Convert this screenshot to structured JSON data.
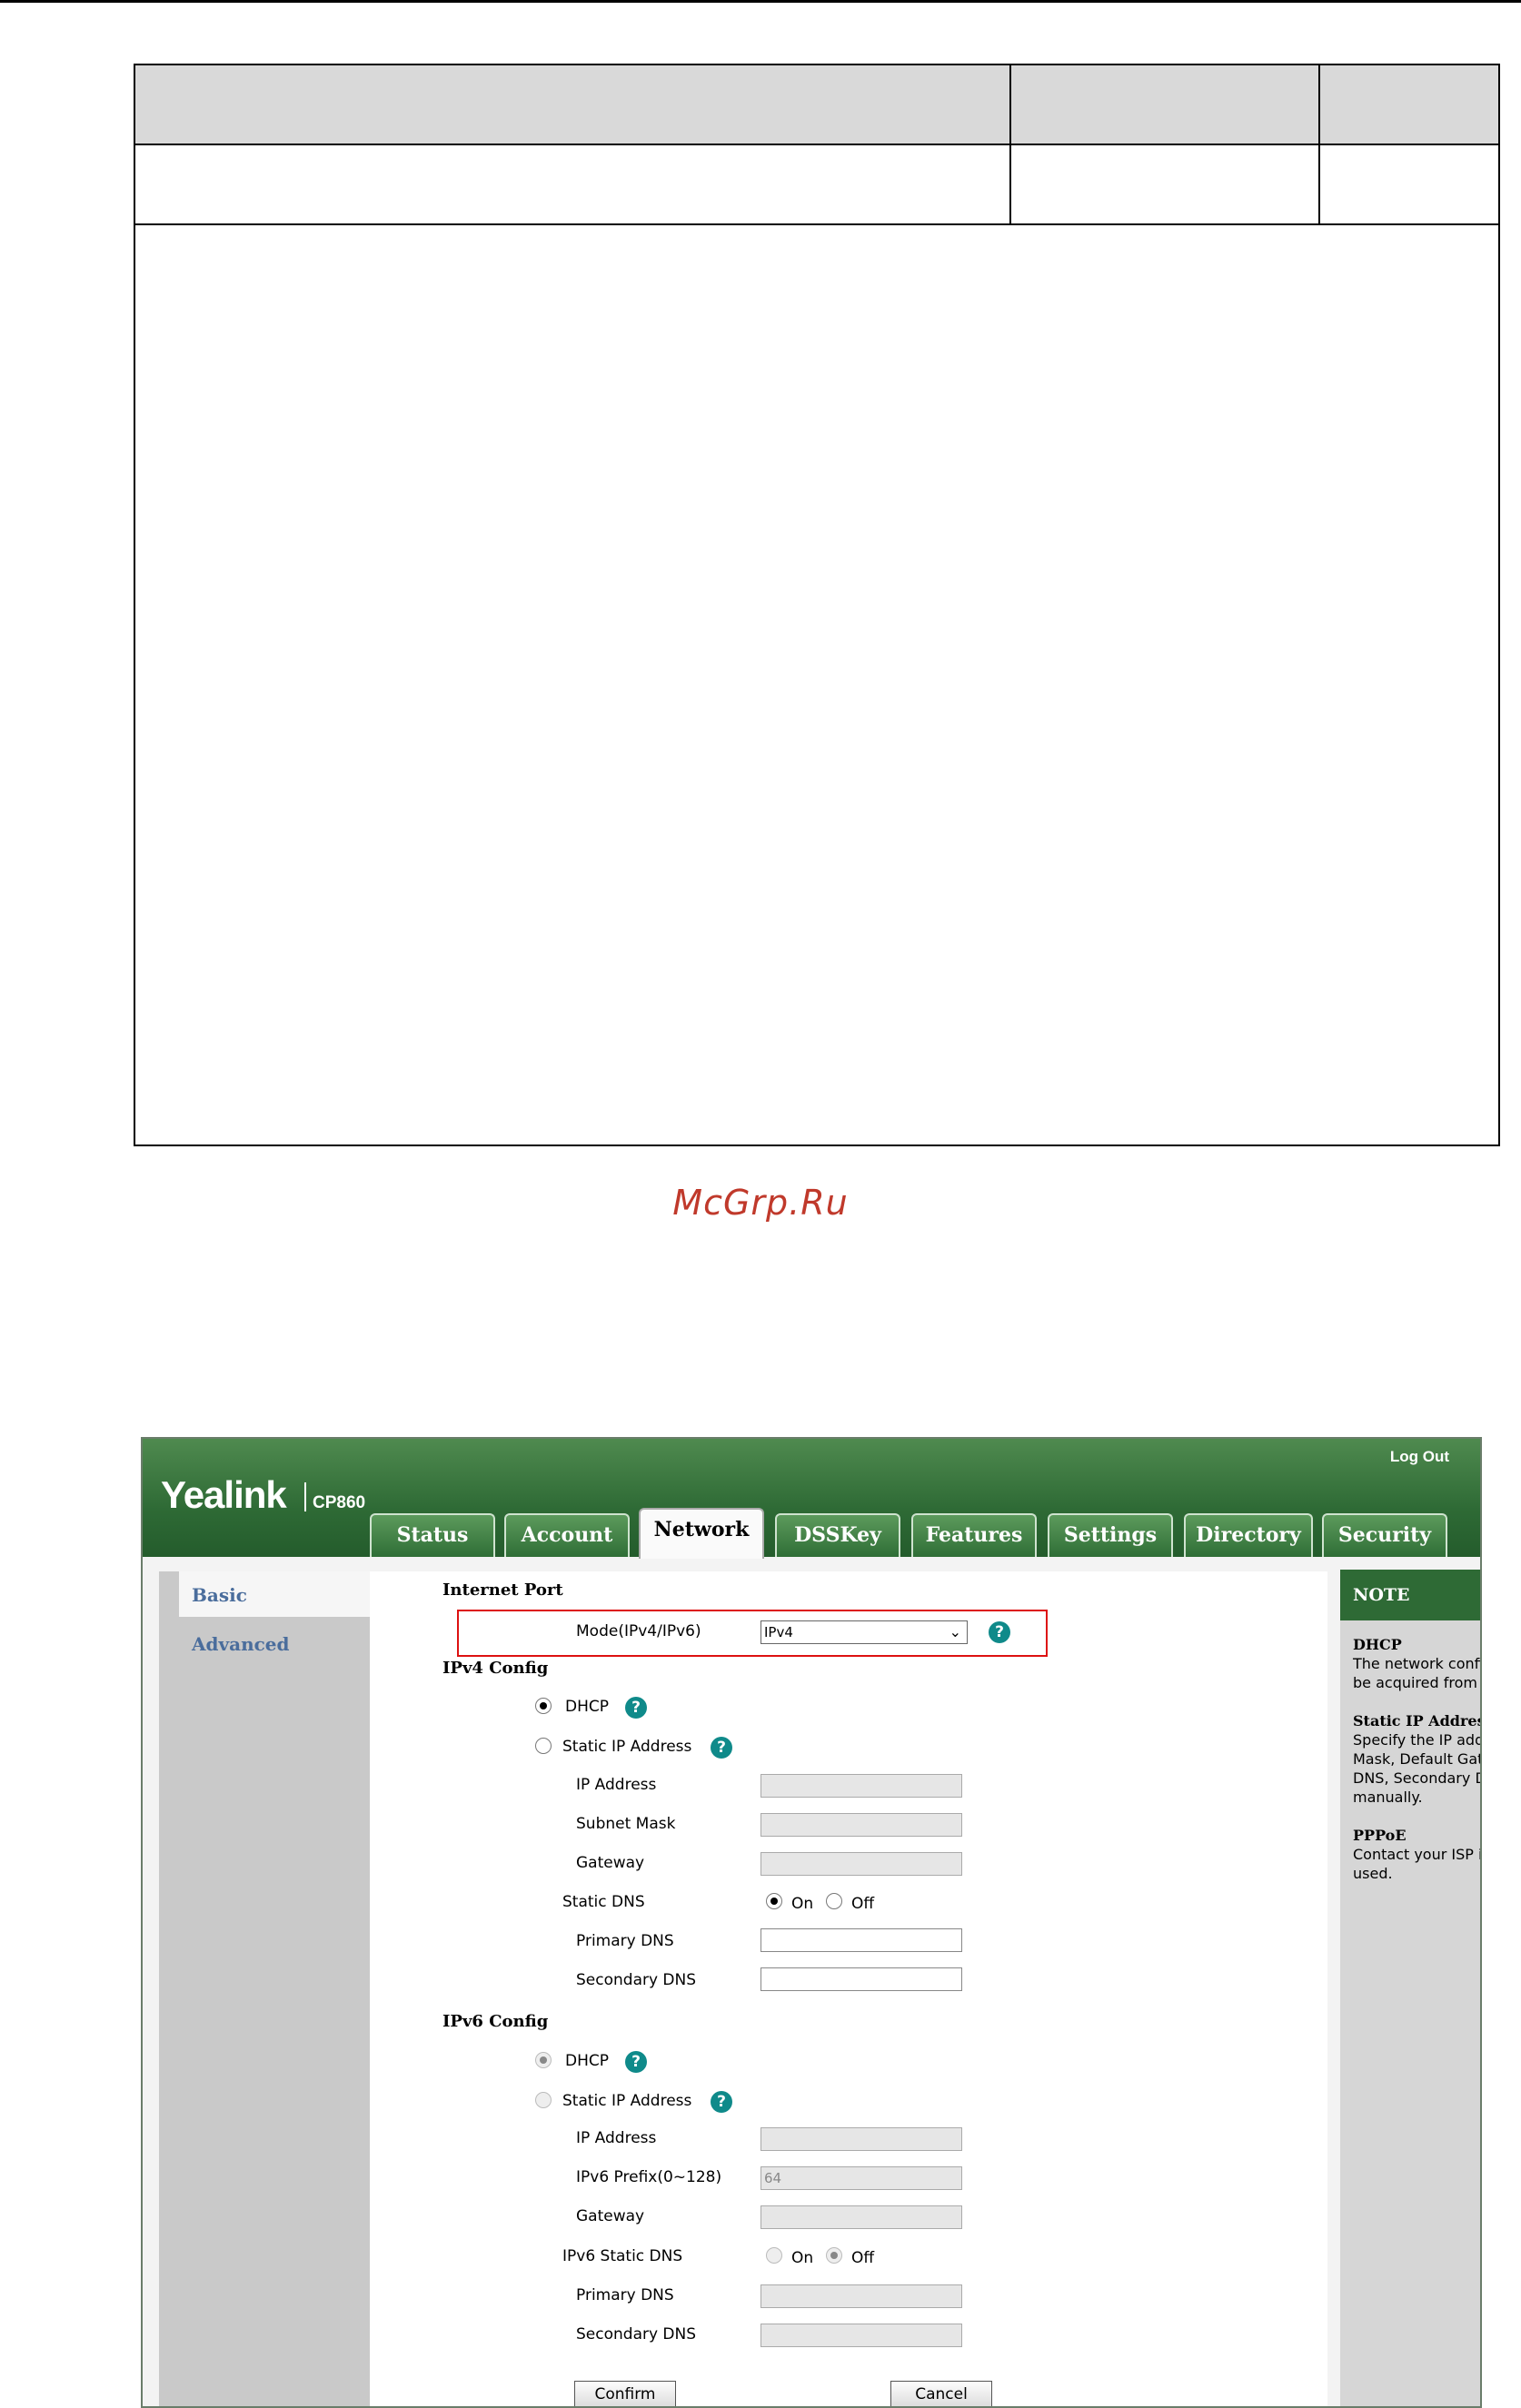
{
  "watermark": "McGrp.Ru",
  "ui": {
    "brand": "Yealink",
    "model": "CP860",
    "logout": "Log Out",
    "tabs": [
      "Status",
      "Account",
      "Network",
      "DSSKey",
      "Features",
      "Settings",
      "Directory",
      "Security"
    ],
    "active_tab": "Network",
    "sidebar": [
      "Basic",
      "Advanced"
    ],
    "internet_port": {
      "title": "Internet Port",
      "mode_label": "Mode(IPv4/IPv6)",
      "mode_value": "IPv4"
    },
    "ipv4": {
      "title": "IPv4 Config",
      "dhcp": "DHCP",
      "static": "Static IP Address",
      "ip": "IP Address",
      "mask": "Subnet Mask",
      "gateway": "Gateway",
      "static_dns": "Static DNS",
      "on": "On",
      "off": "Off",
      "primary_dns": "Primary DNS",
      "secondary_dns": "Secondary DNS"
    },
    "ipv6": {
      "title": "IPv6 Config",
      "dhcp": "DHCP",
      "static": "Static IP Address",
      "ip": "IP Address",
      "prefix": "IPv6 Prefix(0~128)",
      "prefix_value": "64",
      "gateway": "Gateway",
      "static_dns": "IPv6 Static DNS",
      "on": "On",
      "off": "Off",
      "primary_dns": "Primary DNS",
      "secondary_dns": "Secondary DNS"
    },
    "buttons": {
      "confirm": "Confirm",
      "cancel": "Cancel"
    },
    "note": {
      "title": "NOTE",
      "items": [
        {
          "heading": "DHCP",
          "text": "The network configurations will be acquired from DHCP server."
        },
        {
          "heading": "Static IP Address",
          "text": "Specify the IP address, Subnet Mask, Default Gateway, Primary DNS, Secondary DNS fields manually."
        },
        {
          "heading": "PPPoE",
          "text": "Contact your ISP if it should be used."
        }
      ]
    },
    "colors": {
      "header_green": "#2e6a35",
      "accent_orange": "#f39c2b",
      "help_teal": "#0f8a8a",
      "highlight_red": "#dd1111"
    }
  }
}
